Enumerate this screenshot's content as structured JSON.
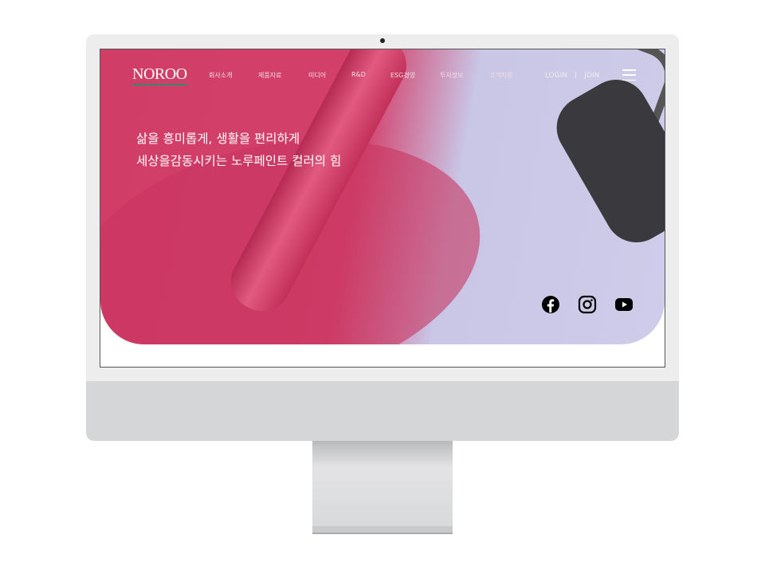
{
  "brand": {
    "logo": "NOROO"
  },
  "nav": {
    "items": [
      "회사소개",
      "제품자료",
      "미디어",
      "R&D",
      "ESG경영",
      "투자정보",
      "고객지원"
    ]
  },
  "auth": {
    "login": "LOGIN",
    "separator": "|",
    "join": "JOIN"
  },
  "hero": {
    "line1": "삶을 흥미롭게, 생활을 편리하게",
    "line2": "세상을감동시키는 노루페인트 컬러의 힘"
  },
  "social": [
    "facebook-icon",
    "instagram-icon",
    "youtube-icon"
  ],
  "colors": {
    "accent": "#d23d67",
    "lavender": "#c9c6e6",
    "logo_underline": "#2f8a72"
  }
}
